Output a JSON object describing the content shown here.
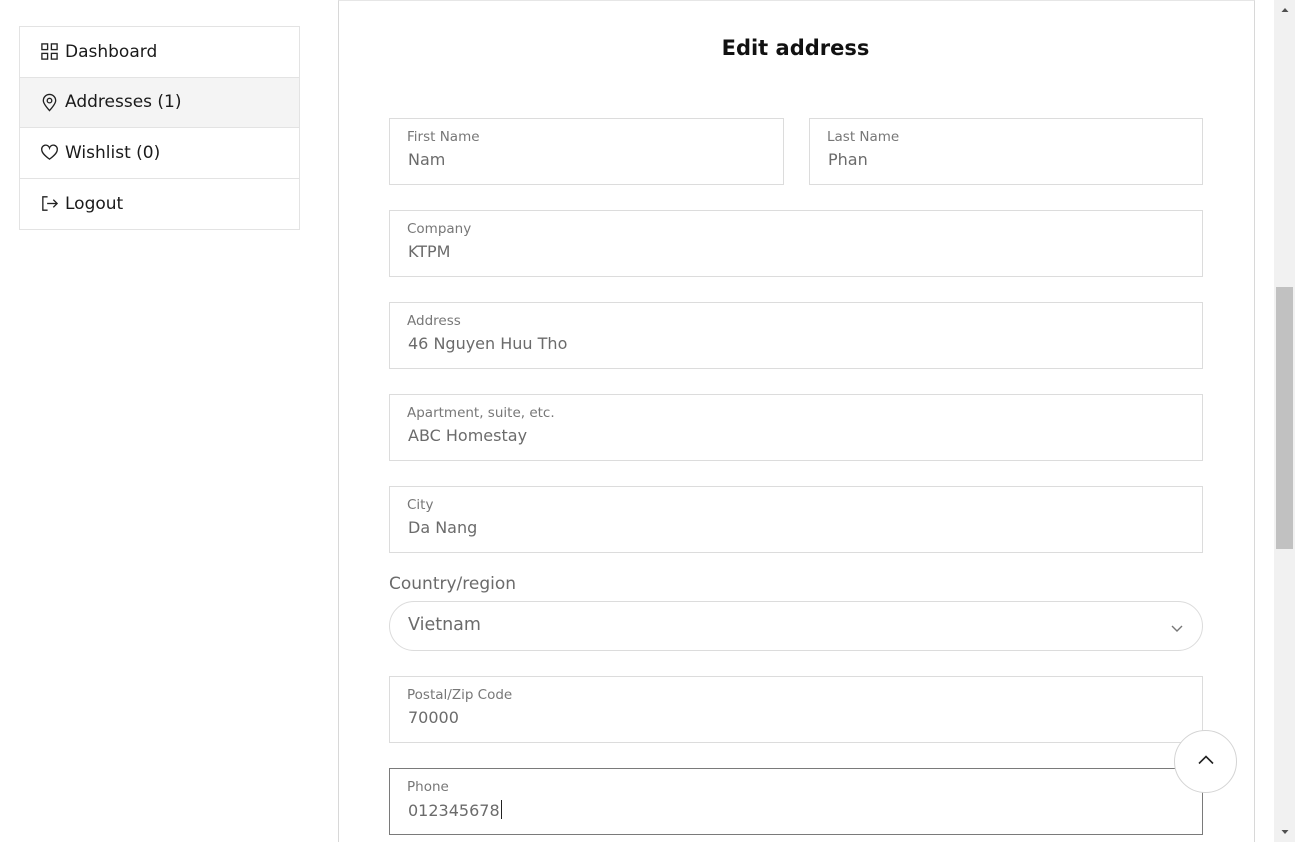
{
  "sidebar": {
    "items": [
      {
        "label": "Dashboard",
        "icon": "grid-icon"
      },
      {
        "label": "Addresses (1)",
        "icon": "map-pin-icon"
      },
      {
        "label": "Wishlist (0)",
        "icon": "heart-icon"
      },
      {
        "label": "Logout",
        "icon": "logout-icon"
      }
    ]
  },
  "form": {
    "title": "Edit address",
    "first_name": {
      "label": "First Name",
      "value": "Nam"
    },
    "last_name": {
      "label": "Last Name",
      "value": "Phan"
    },
    "company": {
      "label": "Company",
      "value": "KTPM"
    },
    "address": {
      "label": "Address",
      "value": "46 Nguyen Huu Tho"
    },
    "apartment": {
      "label": "Apartment, suite, etc.",
      "value": "ABC Homestay"
    },
    "city": {
      "label": "City",
      "value": "Da Nang"
    },
    "country": {
      "label": "Country/region",
      "value": "Vietnam"
    },
    "postal": {
      "label": "Postal/Zip Code",
      "value": "70000"
    },
    "phone": {
      "label": "Phone",
      "value": "012345678"
    }
  }
}
